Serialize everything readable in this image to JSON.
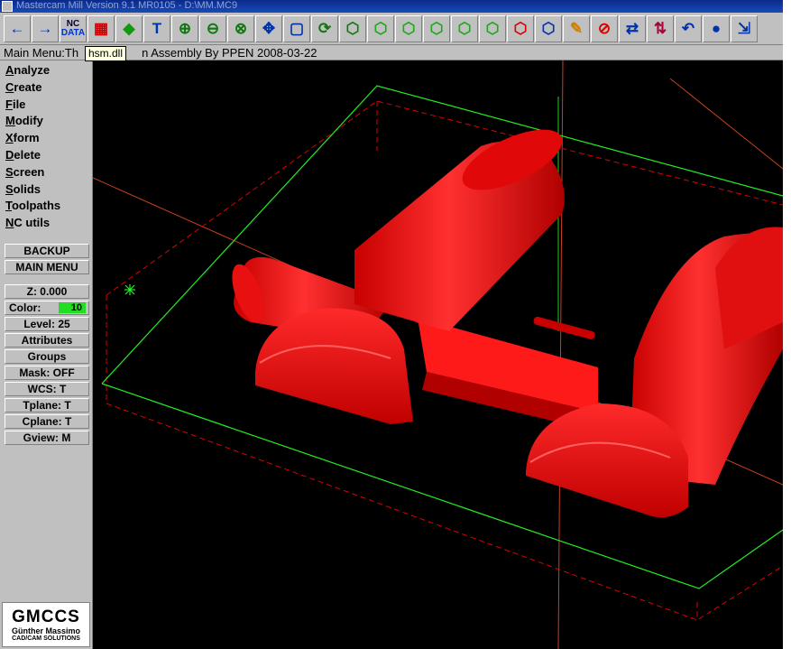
{
  "window": {
    "title": "Mastercam Mill Version 9.1 MR0105 - D:\\MM.MC9"
  },
  "toolbar": {
    "buttons": [
      {
        "name": "back-arrow-icon",
        "glyph": "←"
      },
      {
        "name": "forward-arrow-icon",
        "glyph": "→"
      },
      {
        "name": "nc-data-icon",
        "line1": "NC",
        "line2": "DATA"
      },
      {
        "name": "hsm-dll-icon",
        "glyph": "▦"
      },
      {
        "name": "modify-icon",
        "glyph": "◆"
      },
      {
        "name": "text-tool-icon",
        "glyph": "T"
      },
      {
        "name": "zoom-window-icon",
        "glyph": "⊕"
      },
      {
        "name": "zoom-out-icon",
        "glyph": "⊖"
      },
      {
        "name": "zoom-icon",
        "glyph": "⊗"
      },
      {
        "name": "pan-icon",
        "glyph": "✥"
      },
      {
        "name": "select-icon",
        "glyph": "▢"
      },
      {
        "name": "rotate-view-icon",
        "glyph": "⟳"
      },
      {
        "name": "iso-cube-icon",
        "glyph": "⬡"
      },
      {
        "name": "front-cube-icon",
        "glyph": "⬡"
      },
      {
        "name": "top-cube-icon",
        "glyph": "⬡"
      },
      {
        "name": "side-cube-icon",
        "glyph": "⬡"
      },
      {
        "name": "solid-cube-icon",
        "glyph": "⬡"
      },
      {
        "name": "shaded-cube-icon",
        "glyph": "⬡"
      },
      {
        "name": "red-cube-icon",
        "glyph": "⬡"
      },
      {
        "name": "3d-cube-icon",
        "glyph": "⬡"
      },
      {
        "name": "pencil-icon",
        "glyph": "✎"
      },
      {
        "name": "no-shade-icon",
        "glyph": "⊘"
      },
      {
        "name": "transfer-icon",
        "glyph": "⇄"
      },
      {
        "name": "levels-icon",
        "glyph": "⇅"
      },
      {
        "name": "undo-icon",
        "glyph": "↶"
      },
      {
        "name": "sphere-icon",
        "glyph": "●"
      },
      {
        "name": "export-icon",
        "glyph": "⇲"
      }
    ]
  },
  "tooltip": {
    "text": "hsm.dll"
  },
  "status_line": {
    "prefix": "Main Menu:Th",
    "suffix": "n Assembly By PPEN 2008-03-22"
  },
  "main_menu": {
    "items": [
      {
        "hot": "A",
        "rest": "nalyze"
      },
      {
        "hot": "C",
        "rest": "reate"
      },
      {
        "hot": "F",
        "rest": "ile"
      },
      {
        "hot": "M",
        "rest": "odify"
      },
      {
        "hot": "X",
        "rest": "form"
      },
      {
        "hot": "D",
        "rest": "elete"
      },
      {
        "hot": "S",
        "rest": "creen"
      },
      {
        "hot": "S",
        "rest": "olids"
      },
      {
        "hot": "T",
        "rest": "oolpaths"
      },
      {
        "hot": "N",
        "rest": "C utils"
      }
    ]
  },
  "side_buttons": {
    "backup": "BACKUP",
    "main_menu": "MAIN MENU",
    "z": "Z:  0.000",
    "color_label": "Color:",
    "color_value": "10",
    "color_hex": "#22dd22",
    "level": "Level: 25",
    "attributes": "Attributes",
    "groups": "Groups",
    "mask": "Mask:  OFF",
    "wcs": "WCS:   T",
    "tplane": "Tplane:  T",
    "cplane": "Cplane:  T",
    "gview": "Gview:   M"
  },
  "logo": {
    "brand": "GMCCS",
    "line1": "Günther Massimo",
    "line2": "CAD/CAM SOLUTIONS"
  },
  "colors": {
    "model": "#ff1a1a",
    "model_dark": "#b00000",
    "boundary": "#22ee22",
    "dashed": "#e00000",
    "axis": "#c84020"
  }
}
